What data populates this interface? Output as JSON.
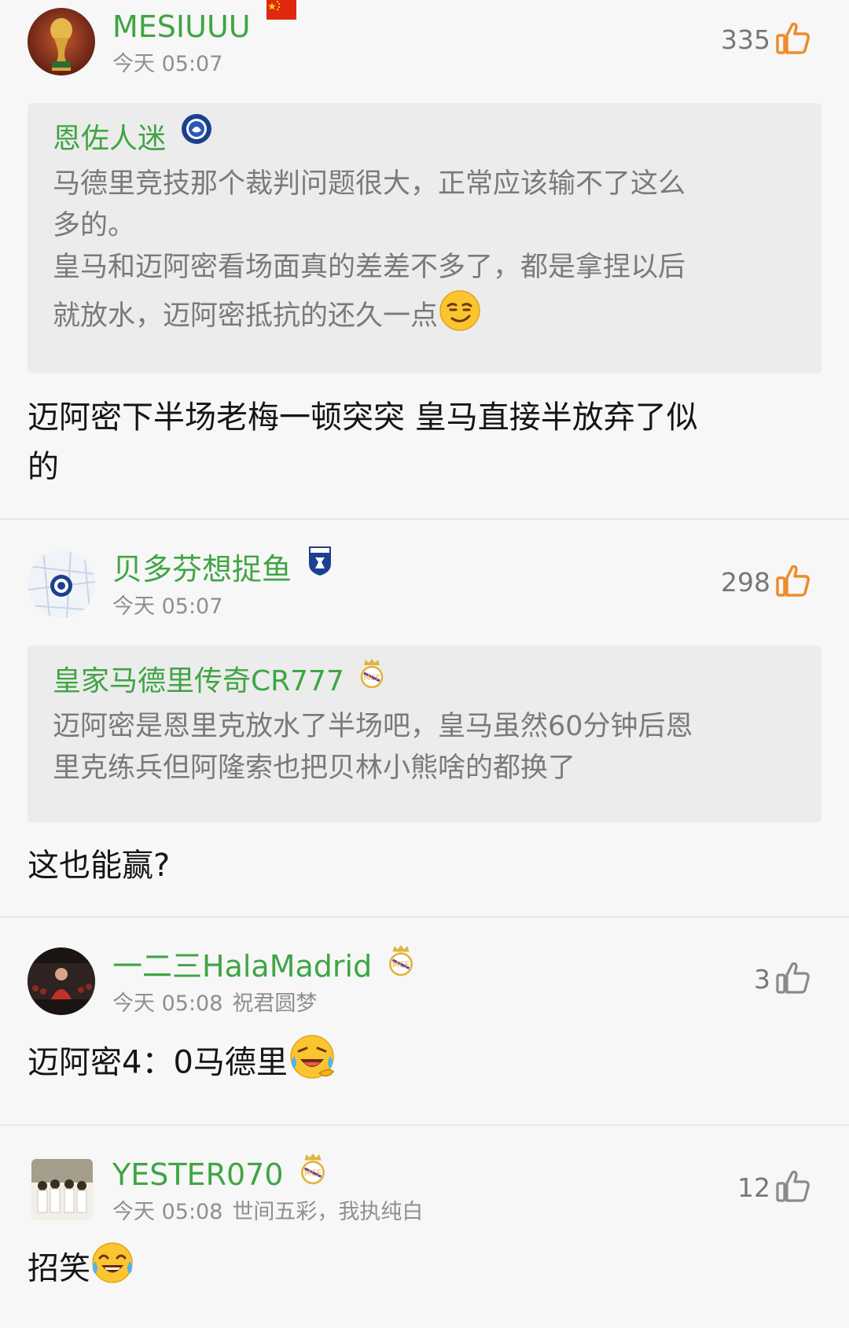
{
  "colors": {
    "username": "#3fa544",
    "like_orange": "#f08a2c",
    "like_gray": "#8a8a8a"
  },
  "comments": [
    {
      "username": "MESIUUU",
      "badge": "china-flag-icon",
      "time": "今天 05:07",
      "likes": "335",
      "liked": true,
      "quote": {
        "username": "恩佐人迷",
        "badge": "chelsea-badge-icon",
        "lines": [
          "马德里竞技那个裁判问题很大，正常应该输不了这么",
          "多的。",
          "皇马和迈阿密看场面真的差差不多了，都是拿捏以后",
          "就放水，迈阿密抵抗的还久一点"
        ]
      },
      "text_lines": [
        "迈阿密下半场老梅一顿突突 皇马直接半放弃了似",
        "的"
      ]
    },
    {
      "username": "贝多芬想捉鱼",
      "badge": "club-crest-icon",
      "time": "今天 05:07",
      "likes": "298",
      "liked": true,
      "quote": {
        "username": "皇家马德里传奇CR777",
        "badge": "real-madrid-badge-icon",
        "lines": [
          "迈阿密是恩里克放水了半场吧，皇马虽然60分钟后恩",
          "里克练兵但阿隆索也把贝林小熊啥的都换了"
        ]
      },
      "text_lines": [
        "这也能赢?"
      ]
    },
    {
      "username": "一二三HalaMadrid",
      "badge": "real-madrid-badge-icon",
      "time": "今天 05:08",
      "signature": "祝君圆梦",
      "likes": "3",
      "liked": false,
      "text_lines": [
        "迈阿密4：0马德里"
      ]
    },
    {
      "username": "YESTER070",
      "badge": "real-madrid-badge-icon",
      "time": "今天 05:08",
      "signature": "世间五彩，我执纯白",
      "likes": "12",
      "liked": false,
      "text_lines": [
        "招笑"
      ]
    }
  ]
}
